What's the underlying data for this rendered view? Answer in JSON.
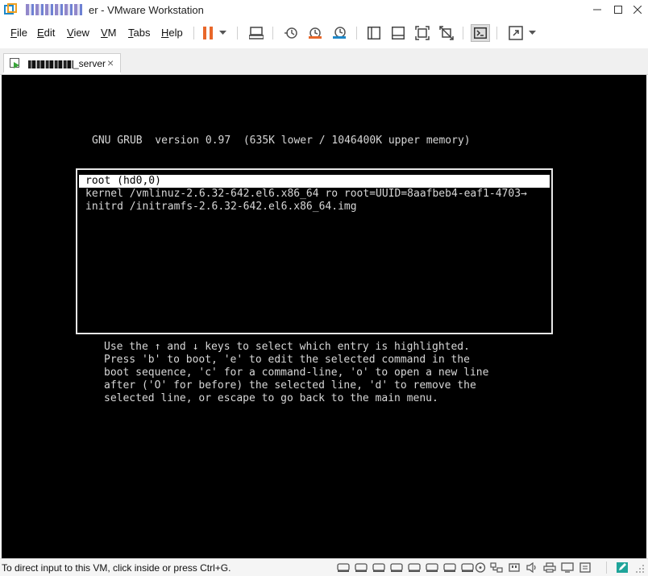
{
  "window": {
    "title_suffix": "er - VMware Workstation",
    "minimize": "—",
    "maximize": "☐",
    "close": "✕"
  },
  "menu": {
    "items": [
      {
        "first": "F",
        "rest": "ile"
      },
      {
        "first": "E",
        "rest": "dit"
      },
      {
        "first": "V",
        "rest": "iew"
      },
      {
        "first": "V",
        "rest": "M"
      },
      {
        "first": "T",
        "rest": "abs"
      },
      {
        "first": "H",
        "rest": "elp"
      }
    ]
  },
  "toolbar": {
    "icons": [
      "pause-icon",
      "dropdown-arrow-icon",
      "send-ctrl-alt-del-icon",
      "snapshot-icon",
      "revert-snapshot-icon",
      "snapshot-manager-icon",
      "show-library-icon",
      "thumbnail-bar-icon",
      "full-screen-icon",
      "unity-icon",
      "console-view-icon",
      "stretch-guest-icon",
      "dropdown-arrow-icon"
    ]
  },
  "tab": {
    "label": "_server",
    "close": "×"
  },
  "console": {
    "header": "GNU GRUB  version 0.97  (635K lower / 1046400K upper memory)",
    "entries": [
      "root (hd0,0)",
      "kernel /vmlinuz-2.6.32-642.el6.x86_64 ro root=UUID=8aafbeb4-eaf1-4703→",
      "initrd /initramfs-2.6.32-642.el6.x86_64.img"
    ],
    "selected_index": 0,
    "help": [
      "Use the ↑ and ↓ keys to select which entry is highlighted.",
      "Press 'b' to boot, 'e' to edit the selected command in the",
      "boot sequence, 'c' for a command-line, 'o' to open a new line",
      "after ('O' for before) the selected line, 'd' to remove the",
      "selected line, or escape to go back to the main menu."
    ]
  },
  "status": {
    "text": "To direct input to this VM, click inside or press Ctrl+G.",
    "icons": [
      "hard-disk-icon",
      "hard-disk-icon",
      "hard-disk-icon",
      "hard-disk-icon",
      "hard-disk-icon",
      "hard-disk-icon",
      "hard-disk-icon",
      "hard-disk-icon",
      "cd-rom-icon",
      "network-adapter-icon",
      "usb-icon",
      "sound-card-icon",
      "printer-icon",
      "display-icon",
      "message-log-icon"
    ]
  },
  "colors": {
    "accent": "#1e88c8",
    "pause": "#e8672a",
    "console_bg": "#000000",
    "console_fg": "#d7d7d7"
  }
}
